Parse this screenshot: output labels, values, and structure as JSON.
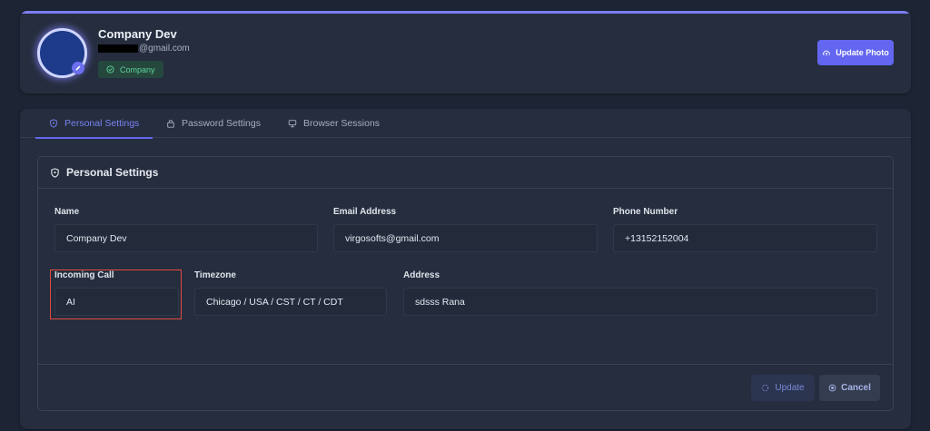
{
  "profile": {
    "name": "Company Dev",
    "email_suffix": "@gmail.com",
    "role_badge": "Company",
    "update_photo_label": "Update Photo"
  },
  "tabs": [
    {
      "label": "Personal Settings",
      "icon": "shield-icon",
      "active": true
    },
    {
      "label": "Password Settings",
      "icon": "lock-icon",
      "active": false
    },
    {
      "label": "Browser Sessions",
      "icon": "monitor-icon",
      "active": false
    }
  ],
  "panel": {
    "title": "Personal Settings",
    "fields": {
      "name": {
        "label": "Name",
        "value": "Company Dev"
      },
      "email": {
        "label": "Email Address",
        "value": "virgosofts@gmail.com"
      },
      "phone": {
        "label": "Phone Number",
        "value": "+13152152004"
      },
      "incoming_call": {
        "label": "Incoming Call",
        "value": "AI"
      },
      "timezone": {
        "label": "Timezone",
        "value": "Chicago / USA / CST / CT / CDT"
      },
      "address": {
        "label": "Address",
        "value": "sdsss Rana"
      }
    }
  },
  "actions": {
    "update_label": "Update",
    "cancel_label": "Cancel"
  },
  "colors": {
    "accent": "#6366f1",
    "background": "#1d2434",
    "card": "#252d3e",
    "badge_text": "#5fd39a",
    "highlight": "#e04a3f"
  }
}
